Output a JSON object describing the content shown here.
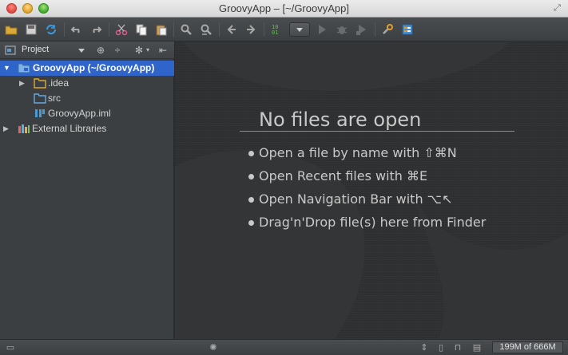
{
  "window": {
    "title": "GroovyApp – [~/GroovyApp]"
  },
  "toolbar": {
    "buttons": [
      "open-folder-icon",
      "save-icon",
      "sync-icon",
      "undo-icon",
      "redo-icon",
      "cut-icon",
      "copy-icon",
      "paste-icon",
      "find-icon",
      "replace-icon",
      "back-icon",
      "forward-icon",
      "build-icon",
      "run-config-dropdown",
      "run-icon",
      "debug-icon",
      "coverage-icon",
      "project-structure-icon",
      "settings-icon"
    ]
  },
  "project_panel": {
    "title": "Project",
    "tree": [
      {
        "label": "GroovyApp (~/GroovyApp)",
        "icon": "module-folder-icon",
        "expanded": true,
        "selected": true,
        "depth": 0
      },
      {
        "label": ".idea",
        "icon": "folder-icon",
        "expanded": false,
        "selected": false,
        "depth": 1
      },
      {
        "label": "src",
        "icon": "source-folder-icon",
        "expanded": false,
        "selected": false,
        "depth": 1
      },
      {
        "label": "GroovyApp.iml",
        "icon": "iml-file-icon",
        "expanded": false,
        "selected": false,
        "depth": 1
      },
      {
        "label": "External Libraries",
        "icon": "libraries-icon",
        "expanded": false,
        "selected": false,
        "depth": 0
      }
    ]
  },
  "editor": {
    "empty_title": "No files are open",
    "hints": [
      "Open a file by name with ⇧⌘N",
      "Open Recent files with ⌘E",
      "Open Navigation Bar with ⌥↖",
      "Drag'n'Drop file(s) here from Finder"
    ]
  },
  "statusbar": {
    "memory": "199M of 666M"
  },
  "colors": {
    "selection": "#2f65ca",
    "panel_bg": "#3c3f41",
    "editor_bg": "#2f3031",
    "text": "#c9c9c9"
  }
}
